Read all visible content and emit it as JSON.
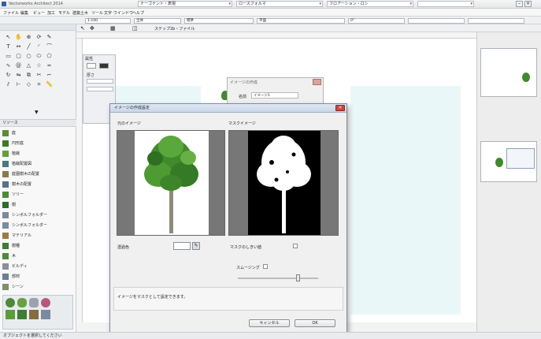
{
  "titlebar": {
    "app_title": "Vectorworks Architect 2014",
    "class_combo": "ナーゴナント・表現",
    "layer_combo": "ロースフォルマ",
    "view_combo": "フロアーション・ロシ",
    "combo4": ""
  },
  "menubar": {
    "items": [
      "ファイル",
      "編集",
      "ビュー",
      "加工",
      "モデル",
      "建築土木",
      "ツール",
      "文字",
      "ウインドウ",
      "ヘルプ"
    ]
  },
  "toolbar": {
    "field1": "1:100",
    "field2": "全体",
    "field3": "標準",
    "field4": "平面",
    "field5": "0°",
    "field6": "",
    "drawing_title": "ステップ2b・ファイル"
  },
  "resource_browser": {
    "title": "リソース",
    "items": [
      {
        "label": "庭",
        "color": "#5b8c3a"
      },
      {
        "label": "円形庭",
        "color": "#3d7a2c"
      },
      {
        "label": "植栽",
        "color": "#6a9d3f"
      },
      {
        "label": "植栽配置図",
        "color": "#447a7e"
      },
      {
        "label": "庭園樹木の配置",
        "color": "#8a7a4f"
      },
      {
        "label": "樹木の配置",
        "color": "#5a6f8f"
      },
      {
        "label": "ツリー",
        "color": "#4d8c35"
      },
      {
        "label": "樹",
        "color": "#2f6d2a"
      },
      {
        "label": "シンボルフォルダー",
        "color": "#7a8aa0"
      },
      {
        "label": "シンボルフォルダー",
        "color": "#7a8aa0"
      },
      {
        "label": "マテリアル",
        "color": "#9c7c45"
      },
      {
        "label": "樹種",
        "color": "#3e7d33"
      },
      {
        "label": "木",
        "color": "#4f8a3b"
      },
      {
        "label": "ビルディ",
        "color": "#8a8f98"
      },
      {
        "label": "部材",
        "color": "#6b7f97"
      },
      {
        "label": "シーン",
        "color": "#7f8f6a"
      }
    ]
  },
  "attr_palette": {
    "title": "属性",
    "label": "厚さ"
  },
  "bg_dialog": {
    "title": "イメージの作成",
    "label": "名前",
    "value": "イメージ1"
  },
  "dialog": {
    "title": "イメージの作成設定",
    "image_label": "元のイメージ",
    "mask_label": "マスクイメージ",
    "transparency_label": "透過色",
    "threshold_label": "マスクのしきい値",
    "slider_label": "スムージング",
    "hint_text": "イメージをマスクとして設定できます。",
    "cancel_label": "キャンセル",
    "ok_label": "OK"
  },
  "status": {
    "text": "オブジェクトを選択してください"
  },
  "colors": {
    "accent": "#c9463d",
    "tree_green": "#3f8a2a",
    "canvas_cyan": "#eaf7f8"
  }
}
